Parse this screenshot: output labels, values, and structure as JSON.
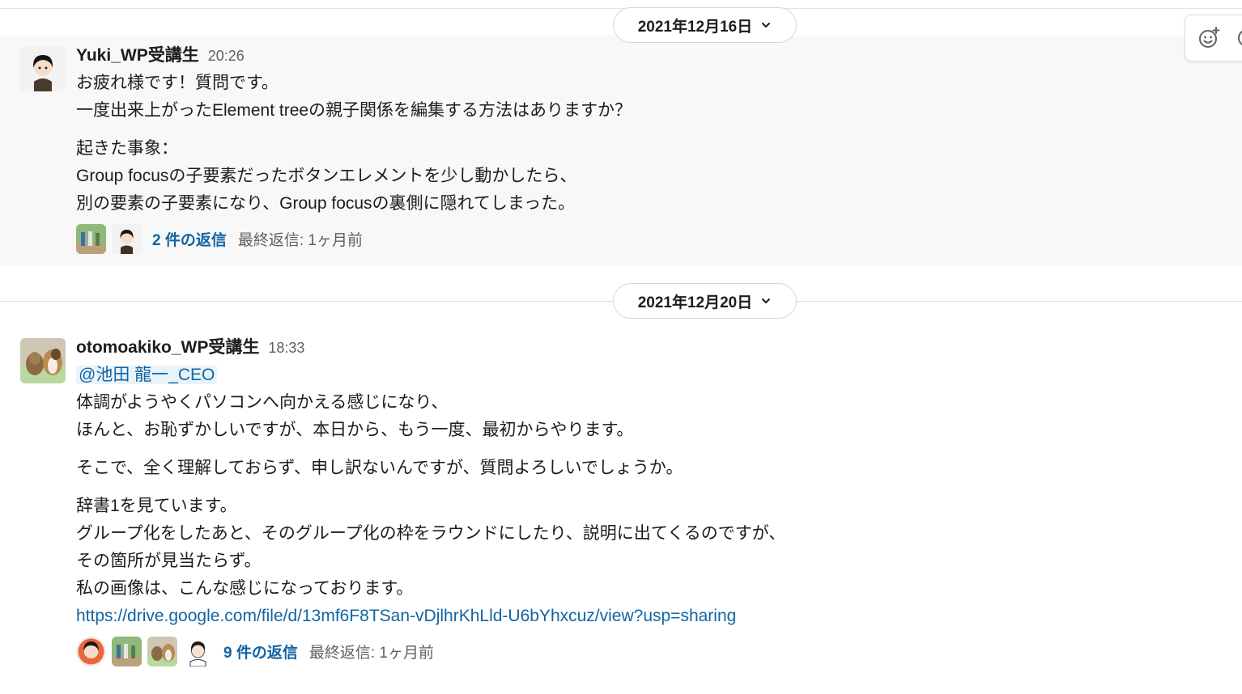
{
  "dates": {
    "first": "2021年12月16日",
    "second": "2021年12月20日"
  },
  "messages": [
    {
      "author": "Yuki_WP受講生",
      "time": "20:26",
      "lines": [
        "お疲れ様です！質問です。",
        "一度出来上がったElement treeの親子関係を編集する方法はありますか？",
        "起きた事象：",
        "Group focusの子要素だったボタンエレメントを少し動かしたら、",
        "別の要素の子要素になり、Group focusの裏側に隠れてしまった。"
      ],
      "reply_count": "2 件の返信",
      "last_reply": "最終返信: 1ヶ月前"
    },
    {
      "author": "otomoakiko_WP受講生",
      "time": "18:33",
      "mention": "@池田 龍一_CEO",
      "lines": [
        "体調がようやくパソコンへ向かえる感じになり、",
        "ほんと、お恥ずかしいですが、本日から、もう一度、最初からやります。",
        "そこで、全く理解しておらず、申し訳ないんですが、質問よろしいでしょうか。",
        "辞書1を見ています。",
        "グループ化をしたあと、そのグループ化の枠をラウンドにしたり、説明に出てくるのですが、",
        "その箇所が見当たらず。",
        "私の画像は、こんな感じになっております。"
      ],
      "link": "https://drive.google.com/file/d/13mf6F8TSan-vDjlhrKhLld-U6bYhxcuz/view?usp=sharing",
      "reply_count": "9 件の返信",
      "last_reply": "最終返信: 1ヶ月前"
    }
  ],
  "icons": {
    "date_chevron": "chevron-down-icon",
    "reaction": "add-reaction-icon",
    "reply": "reply-icon"
  },
  "colors": {
    "link": "#1264a3",
    "mention_bg": "#e8f4fa",
    "hover_bg": "#f8f8f8",
    "muted_text": "#616061"
  }
}
